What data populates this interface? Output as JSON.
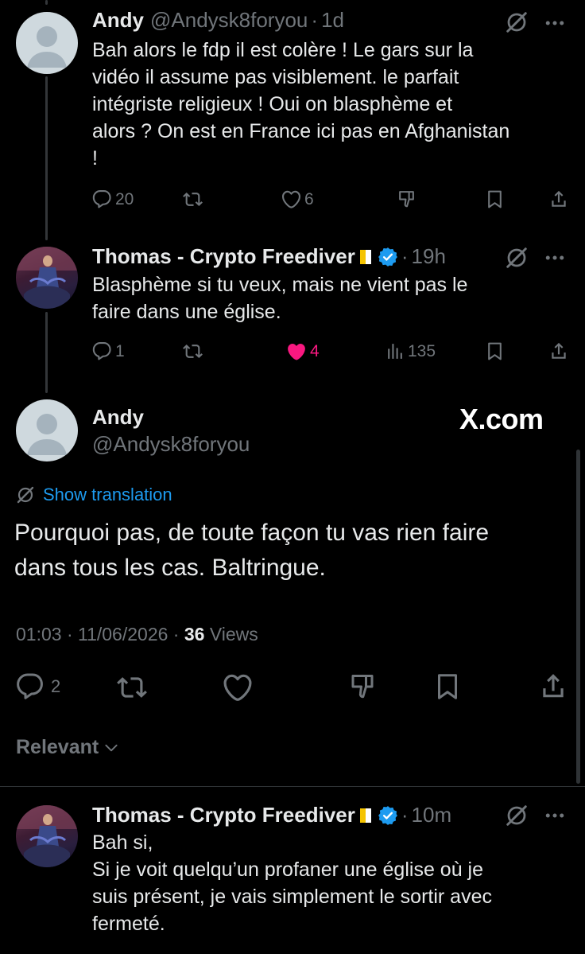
{
  "reply1": {
    "name": "Andy",
    "handle": "@Andysk8foryou",
    "time": "1d",
    "text_lines": [
      "Bah alors le fdp il est colère ! Le gars sur la",
      "vidéo il assume pas visiblement. le parfait",
      "intégriste religieux ! Oui on blasphème et",
      "alors ? On est en France ici pas en Afghanistan",
      "!"
    ],
    "replies": "20",
    "likes": "6"
  },
  "reply2": {
    "name": "Thomas - Crypto Freediver",
    "time": "19h",
    "text_lines": [
      "Blasphème si tu veux, mais ne vient pas le",
      "faire dans une église."
    ],
    "replies": "1",
    "likes": "4",
    "views": "135"
  },
  "main_tweet": {
    "name": "Andy",
    "handle": "@Andysk8foryou",
    "watermark": "X.com",
    "show_translation": "Show translation",
    "text_lines": [
      "Pourquoi pas, de toute façon tu vas rien faire",
      "dans tous les cas. Baltringue."
    ],
    "timestamp": "01:03 · 11/06/2026 · ",
    "views_count": "36",
    "views_label": " Views",
    "replies": "2"
  },
  "sort": {
    "label": "Relevant"
  },
  "reply3": {
    "name": "Thomas - Crypto Freediver",
    "time": "10m",
    "text_lines": [
      "Bah si,",
      "Si je voit quelqu’un profaner une église où je",
      "suis présent, je vais simplement le sortir avec",
      "fermeté."
    ]
  },
  "colors": {
    "background": "#000000",
    "text": "#e7e9ea",
    "muted": "#71767b",
    "link": "#1d9bf0",
    "like": "#f91880",
    "divider": "#2f3336"
  },
  "icons": [
    "grok-icon",
    "more-icon",
    "reply-icon",
    "retweet-icon",
    "like-icon",
    "dislike-icon",
    "bookmark-icon",
    "share-icon",
    "views-icon",
    "verified-badge-icon",
    "flag-icon",
    "translate-icon",
    "chevron-down-icon"
  ]
}
